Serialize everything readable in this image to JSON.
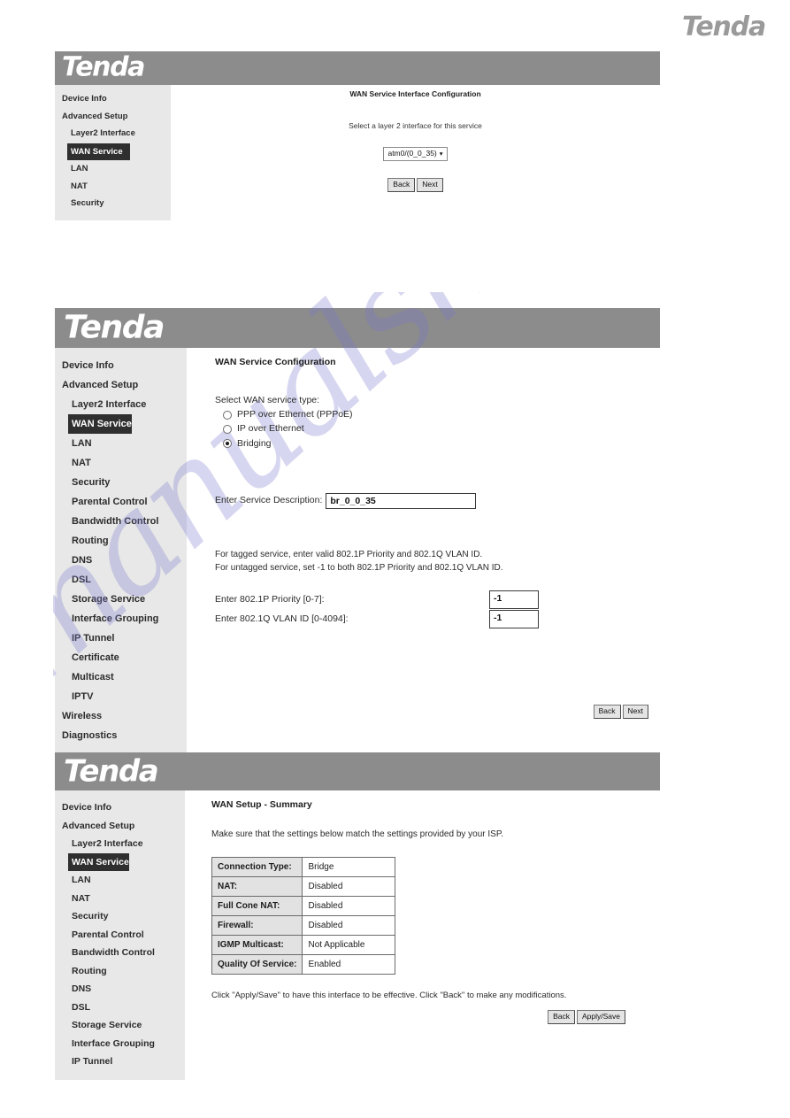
{
  "page": {
    "brand": "Tenda",
    "watermark": "manualshive.com"
  },
  "panel1": {
    "logo": "Tenda",
    "sidebar": [
      {
        "label": "Device Info",
        "level": 1,
        "active": false
      },
      {
        "label": "Advanced Setup",
        "level": 1,
        "active": false
      },
      {
        "label": "Layer2 Interface",
        "level": 2,
        "active": false
      },
      {
        "label": "WAN Service",
        "level": 2,
        "active": true
      },
      {
        "label": "LAN",
        "level": 2,
        "active": false
      },
      {
        "label": "NAT",
        "level": 2,
        "active": false
      },
      {
        "label": "Security",
        "level": 2,
        "active": false
      }
    ],
    "title": "WAN Service Interface Configuration",
    "subtitle": "Select a layer 2 interface for this service",
    "interface_select": {
      "value": "atm0/(0_0_35)",
      "caret": "chevron-down"
    },
    "buttons": {
      "back": "Back",
      "next": "Next"
    }
  },
  "panel2": {
    "logo": "Tenda",
    "sidebar": [
      {
        "label": "Device Info",
        "level": 1,
        "active": false
      },
      {
        "label": "Advanced Setup",
        "level": 1,
        "active": false
      },
      {
        "label": "Layer2 Interface",
        "level": 2,
        "active": false
      },
      {
        "label": "WAN Service",
        "level": 2,
        "active": true
      },
      {
        "label": "LAN",
        "level": 2,
        "active": false
      },
      {
        "label": "NAT",
        "level": 2,
        "active": false
      },
      {
        "label": "Security",
        "level": 2,
        "active": false
      },
      {
        "label": "Parental Control",
        "level": 2,
        "active": false
      },
      {
        "label": "Bandwidth Control",
        "level": 2,
        "active": false
      },
      {
        "label": "Routing",
        "level": 2,
        "active": false
      },
      {
        "label": "DNS",
        "level": 2,
        "active": false
      },
      {
        "label": "DSL",
        "level": 2,
        "active": false
      },
      {
        "label": "Storage Service",
        "level": 2,
        "active": false
      },
      {
        "label": "Interface Grouping",
        "level": 2,
        "active": false
      },
      {
        "label": "IP Tunnel",
        "level": 2,
        "active": false
      },
      {
        "label": "Certificate",
        "level": 2,
        "active": false
      },
      {
        "label": "Multicast",
        "level": 2,
        "active": false
      },
      {
        "label": "IPTV",
        "level": 2,
        "active": false
      },
      {
        "label": "Wireless",
        "level": 1,
        "active": false
      },
      {
        "label": "Diagnostics",
        "level": 1,
        "active": false
      }
    ],
    "title": "WAN Service Configuration",
    "service_type_label": "Select WAN service type:",
    "service_types": [
      {
        "label": "PPP over Ethernet (PPPoE)",
        "selected": false
      },
      {
        "label": "IP over Ethernet",
        "selected": false
      },
      {
        "label": "Bridging",
        "selected": true
      }
    ],
    "description_label": "Enter Service Description:",
    "description_value": "br_0_0_35",
    "note_line1": "For tagged service, enter valid 802.1P Priority and 802.1Q VLAN ID.",
    "note_line2": "For untagged service, set -1 to both 802.1P Priority and 802.1Q VLAN ID.",
    "priority_label": "Enter 802.1P Priority [0-7]:",
    "priority_value": "-1",
    "vlan_label": "Enter 802.1Q VLAN ID [0-4094]:",
    "vlan_value": "-1",
    "buttons": {
      "back": "Back",
      "next": "Next"
    }
  },
  "panel3": {
    "logo": "Tenda",
    "sidebar": [
      {
        "label": "Device Info",
        "level": 1,
        "active": false
      },
      {
        "label": "Advanced Setup",
        "level": 1,
        "active": false
      },
      {
        "label": "Layer2 Interface",
        "level": 2,
        "active": false
      },
      {
        "label": "WAN Service",
        "level": 2,
        "active": true
      },
      {
        "label": "LAN",
        "level": 2,
        "active": false
      },
      {
        "label": "NAT",
        "level": 2,
        "active": false
      },
      {
        "label": "Security",
        "level": 2,
        "active": false
      },
      {
        "label": "Parental Control",
        "level": 2,
        "active": false
      },
      {
        "label": "Bandwidth Control",
        "level": 2,
        "active": false
      },
      {
        "label": "Routing",
        "level": 2,
        "active": false
      },
      {
        "label": "DNS",
        "level": 2,
        "active": false
      },
      {
        "label": "DSL",
        "level": 2,
        "active": false
      },
      {
        "label": "Storage Service",
        "level": 2,
        "active": false
      },
      {
        "label": "Interface Grouping",
        "level": 2,
        "active": false
      },
      {
        "label": "IP Tunnel",
        "level": 2,
        "active": false
      }
    ],
    "title": "WAN Setup - Summary",
    "intro": "Make sure that the settings below match the settings provided by your ISP.",
    "summary_rows": [
      {
        "key": "Connection Type:",
        "value": "Bridge"
      },
      {
        "key": "NAT:",
        "value": "Disabled"
      },
      {
        "key": "Full Cone NAT:",
        "value": "Disabled"
      },
      {
        "key": "Firewall:",
        "value": "Disabled"
      },
      {
        "key": "IGMP Multicast:",
        "value": "Not Applicable"
      },
      {
        "key": "Quality Of Service:",
        "value": "Enabled"
      }
    ],
    "footnote": "Click \"Apply/Save\" to have this interface to be effective. Click \"Back\" to make any modifications.",
    "buttons": {
      "back": "Back",
      "apply": "Apply/Save"
    }
  }
}
